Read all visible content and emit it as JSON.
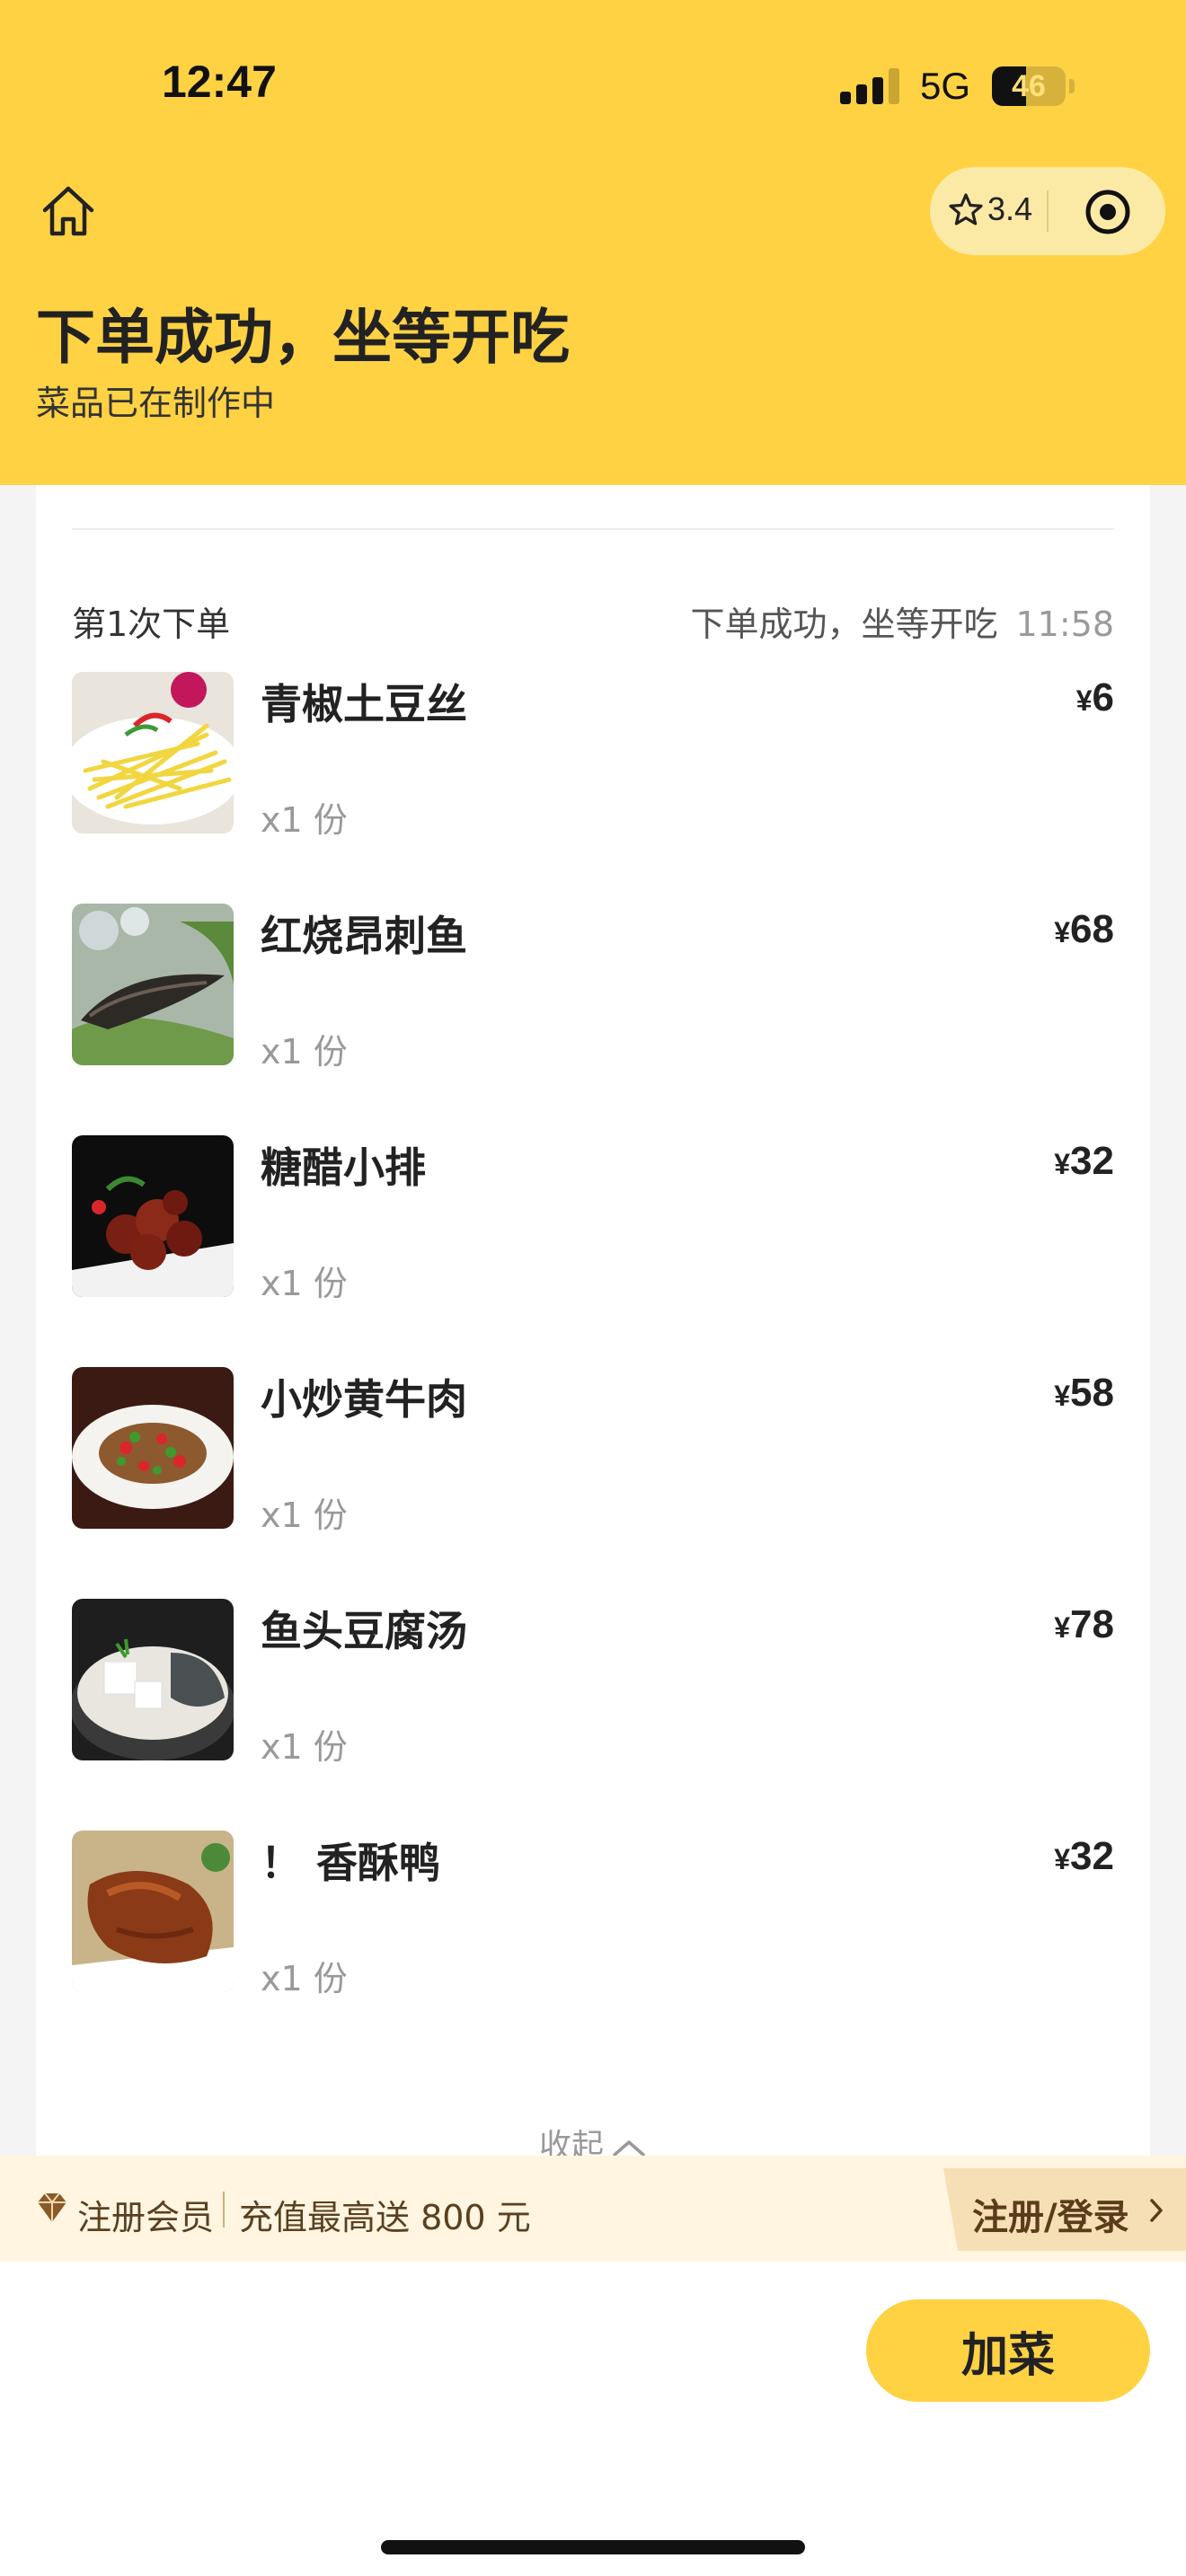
{
  "status_bar": {
    "time": "12:47",
    "network": "5G",
    "battery": "46",
    "battery_level": 0.46
  },
  "capsule": {
    "rating": "3.4",
    "icons": [
      "star-icon",
      "target-icon"
    ]
  },
  "header": {
    "title": "下单成功，坐等开吃",
    "subtitle": "菜品已在制作中"
  },
  "order": {
    "label": "第1次下单",
    "status": "下单成功，坐等开吃",
    "time": "11:58",
    "items": [
      {
        "name": "青椒土豆丝",
        "qty": "x1 份",
        "currency": "¥",
        "price": "6"
      },
      {
        "name": "红烧昂刺鱼",
        "qty": "x1 份",
        "currency": "¥",
        "price": "68"
      },
      {
        "name": "糖醋小排",
        "qty": "x1 份",
        "currency": "¥",
        "price": "32"
      },
      {
        "name": "小炒黄牛肉",
        "qty": "x1 份",
        "currency": "¥",
        "price": "58"
      },
      {
        "name": "鱼头豆腐汤",
        "qty": "x1 份",
        "currency": "¥",
        "price": "78"
      },
      {
        "name": "！ 香酥鸭",
        "qty": "x1 份",
        "currency": "¥",
        "price": "32"
      }
    ],
    "collapse_label": "收起"
  },
  "promo": {
    "member_label": "注册会员",
    "recharge_label": "充值最高送 800 元",
    "register_label": "注册/登录"
  },
  "actions": {
    "add_dish_label": "加菜"
  },
  "colors": {
    "accent": "#ffd244",
    "promo_bg": "#fff5e0"
  }
}
